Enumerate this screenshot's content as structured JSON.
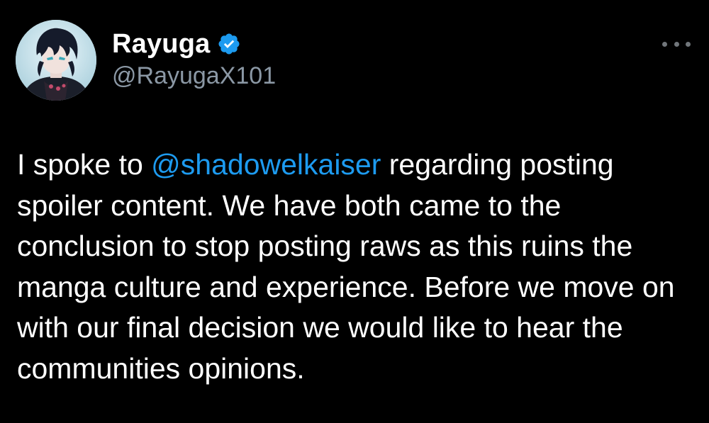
{
  "user": {
    "display_name": "Rayuga",
    "handle": "@RayugaX101",
    "verified": true,
    "avatar_icon": "anime-character-avatar"
  },
  "menu": {
    "icon": "more-options-icon"
  },
  "tweet": {
    "text_before_mention": "I spoke to ",
    "mention": "@shadowelkaiser",
    "text_after_mention": " regarding posting spoiler content. We have both came to the conclusion to stop posting raws as this ruins the manga culture and experience. Before we move on with our final decision we would like to hear the communities opinions."
  },
  "colors": {
    "background": "#000000",
    "text": "#ffffff",
    "secondary_text": "#8b98a5",
    "link": "#1d9bf0",
    "verified_badge": "#1d9bf0"
  }
}
